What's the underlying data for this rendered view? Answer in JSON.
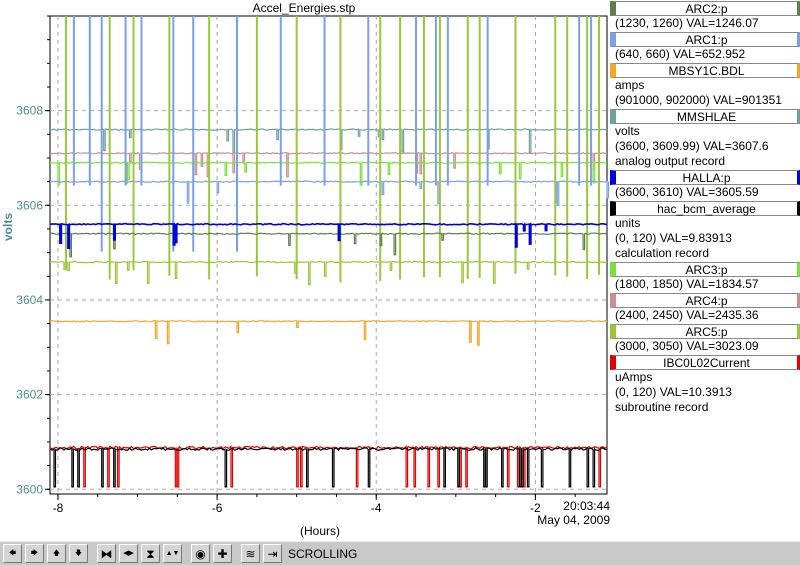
{
  "chart_data": {
    "type": "line",
    "title": "Accel_Energies.stp",
    "ylabel": "volts",
    "xlabel": "(Hours)",
    "xlim": [
      -8.1,
      -1.1
    ],
    "ylim": [
      3599.9,
      3610
    ],
    "x_ticks": [
      -8,
      -6,
      -4,
      -2
    ],
    "y_ticks": [
      3600,
      3602,
      3604,
      3606,
      3608
    ],
    "grid": true,
    "legend_placement": "right",
    "timestamp": "20:03:44",
    "date": "May 04, 2009",
    "series": [
      {
        "name": "ARC2:p",
        "color": "#5f7f4f",
        "range": "(1230, 1260)",
        "value_text": "VAL=1246.07",
        "level": 3605.4
      },
      {
        "name": "ARC1:p",
        "color": "#7aa0e6",
        "range": "(640, 660)",
        "value_text": "VAL=652.952",
        "level": 3606.5
      },
      {
        "name": "MBSY1C.BDL",
        "color": "#f5a623",
        "unit": "amps",
        "range": "(901000, 902000)",
        "value_text": "VAL=901351",
        "level": 3603.55
      },
      {
        "name": "MMSHLAE",
        "color": "#6fa0a0",
        "unit": "volts",
        "range": "(3600, 3609.99)",
        "value_text": "VAL=3607.6",
        "record": "analog output record",
        "level": 3607.6
      },
      {
        "name": "HALLA:p",
        "color": "#0000dd",
        "range": "(3600, 3610)",
        "value_text": "VAL=3605.59",
        "level": 3605.6
      },
      {
        "name": "hac_bcm_average",
        "color": "#000000",
        "unit": "units",
        "range": "(0, 120)",
        "value_text": "VAL=9.83913",
        "record": "calculation record",
        "level": 3600.85
      },
      {
        "name": "ARC3:p",
        "color": "#7ce03a",
        "range": "(1800, 1850)",
        "value_text": "VAL=1834.57",
        "level": 3606.9
      },
      {
        "name": "ARC4:p",
        "color": "#c89090",
        "range": "(2400, 2450)",
        "value_text": "VAL=2435.36",
        "level": 3607.1
      },
      {
        "name": "ARC5:p",
        "color": "#9ac83a",
        "range": "(3000, 3050)",
        "value_text": "VAL=3023.09",
        "level": 3604.8
      },
      {
        "name": "IBC0L02Current",
        "color": "#e00000",
        "unit": "uAmps",
        "range": "(0, 120)",
        "value_text": "VAL=10.3913",
        "record": "subroutine record",
        "level": 3600.88
      }
    ]
  },
  "toolbar": {
    "buttons": [
      {
        "name": "left-arrow-icon",
        "glyph": "🡄"
      },
      {
        "name": "right-arrow-icon",
        "glyph": "🡆"
      },
      {
        "name": "up-arrow-icon",
        "glyph": "🡅"
      },
      {
        "name": "down-arrow-icon",
        "glyph": "🡇"
      },
      {
        "name": "zoom-in-horizontal-icon",
        "glyph": "⧓"
      },
      {
        "name": "zoom-out-horizontal-icon",
        "glyph": "◀▶"
      },
      {
        "name": "zoom-in-vertical-icon",
        "glyph": "⧗"
      },
      {
        "name": "zoom-out-vertical-icon",
        "glyph": "▲▼"
      },
      {
        "name": "reset-icon",
        "glyph": "◉"
      },
      {
        "name": "add-icon",
        "glyph": "✚"
      },
      {
        "name": "autoscale-icon",
        "glyph": "≋"
      },
      {
        "name": "latest-icon",
        "glyph": "⇥"
      }
    ],
    "mode_label": "SCROLLING"
  }
}
